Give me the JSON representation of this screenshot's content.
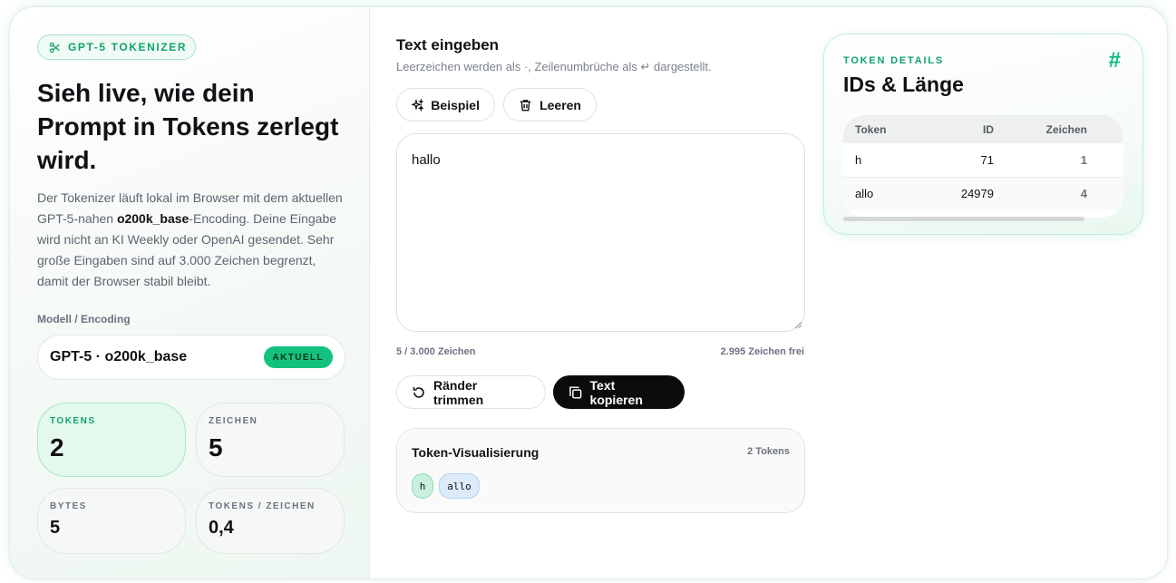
{
  "left": {
    "tag": "GPT-5 TOKENIZER",
    "hero": "Sieh live, wie dein Prompt in Tokens zerlegt wird.",
    "desc_part1": "Der Tokenizer läuft lokal im Browser mit dem aktuellen GPT-5-nahen ",
    "desc_bold": "o200k_base",
    "desc_part2": "-Encoding. Deine Eingabe wird nicht an KI Weekly oder OpenAI gesendet. Sehr große Eingaben sind auf 3.000 Zeichen begrenzt, damit der Browser stabil bleibt.",
    "model_label": "Modell / Encoding",
    "model_name": "GPT-5 · o200k_base",
    "model_badge": "AKTUELL",
    "stats": [
      {
        "label": "TOKENS",
        "value": "2"
      },
      {
        "label": "ZEICHEN",
        "value": "5"
      },
      {
        "label": "BYTES",
        "value": "5"
      },
      {
        "label": "TOKENS / ZEICHEN",
        "value": "0,4"
      }
    ]
  },
  "middle": {
    "title": "Text eingeben",
    "subtitle": "Leerzeichen werden als ·, Zeilenumbrüche als ↵ dargestellt.",
    "btn_example": "Beispiel",
    "btn_clear": "Leeren",
    "text_value": "hallo",
    "count_used": "5 / 3.000 Zeichen",
    "count_free": "2.995 Zeichen frei",
    "btn_trim": "Ränder trimmen",
    "btn_copy": "Text kopieren",
    "viz_title": "Token-Visualisierung",
    "viz_count": "2 Tokens",
    "chips": [
      "h",
      "allo"
    ]
  },
  "right": {
    "label": "TOKEN DETAILS",
    "title": "IDs & Länge",
    "hash": "#",
    "columns": [
      "Token",
      "ID",
      "Zeichen"
    ],
    "rows": [
      {
        "token": "h",
        "id": "71",
        "chars": "1"
      },
      {
        "token": "allo",
        "id": "24979",
        "chars": "4"
      }
    ]
  },
  "colors": {
    "accent": "#10a36b",
    "badge": "#13c27e",
    "chip_green": "#c9f0dc",
    "chip_blue": "#dcebf9",
    "dark_button": "#0b0b0c"
  }
}
